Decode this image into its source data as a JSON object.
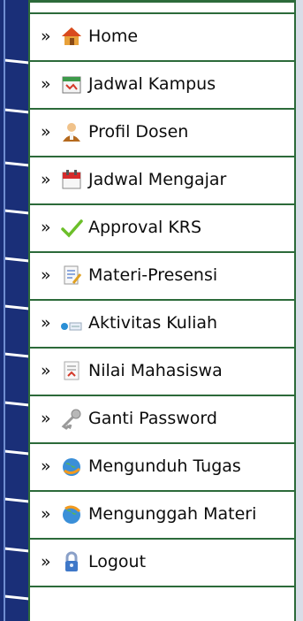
{
  "menu": {
    "bullet": "»",
    "items": [
      {
        "label": "Home",
        "icon": "home-icon"
      },
      {
        "label": "Jadwal Kampus",
        "icon": "calendar-icon"
      },
      {
        "label": "Profil Dosen",
        "icon": "user-icon"
      },
      {
        "label": "Jadwal Mengajar",
        "icon": "date-icon"
      },
      {
        "label": "Approval KRS",
        "icon": "checkmark-icon"
      },
      {
        "label": "Materi-Presensi",
        "icon": "document-edit-icon"
      },
      {
        "label": "Aktivitas Kuliah",
        "icon": "activity-icon"
      },
      {
        "label": "Nilai Mahasiswa",
        "icon": "grades-icon"
      },
      {
        "label": "Ganti Password",
        "icon": "key-icon"
      },
      {
        "label": "Mengunduh Tugas",
        "icon": "download-globe-icon"
      },
      {
        "label": "Mengunggah Materi",
        "icon": "upload-globe-icon"
      },
      {
        "label": "Logout",
        "icon": "lock-icon"
      }
    ]
  },
  "colors": {
    "rail": "#1a2f78",
    "border": "#2c6a3a",
    "text": "#0c0c0c"
  }
}
